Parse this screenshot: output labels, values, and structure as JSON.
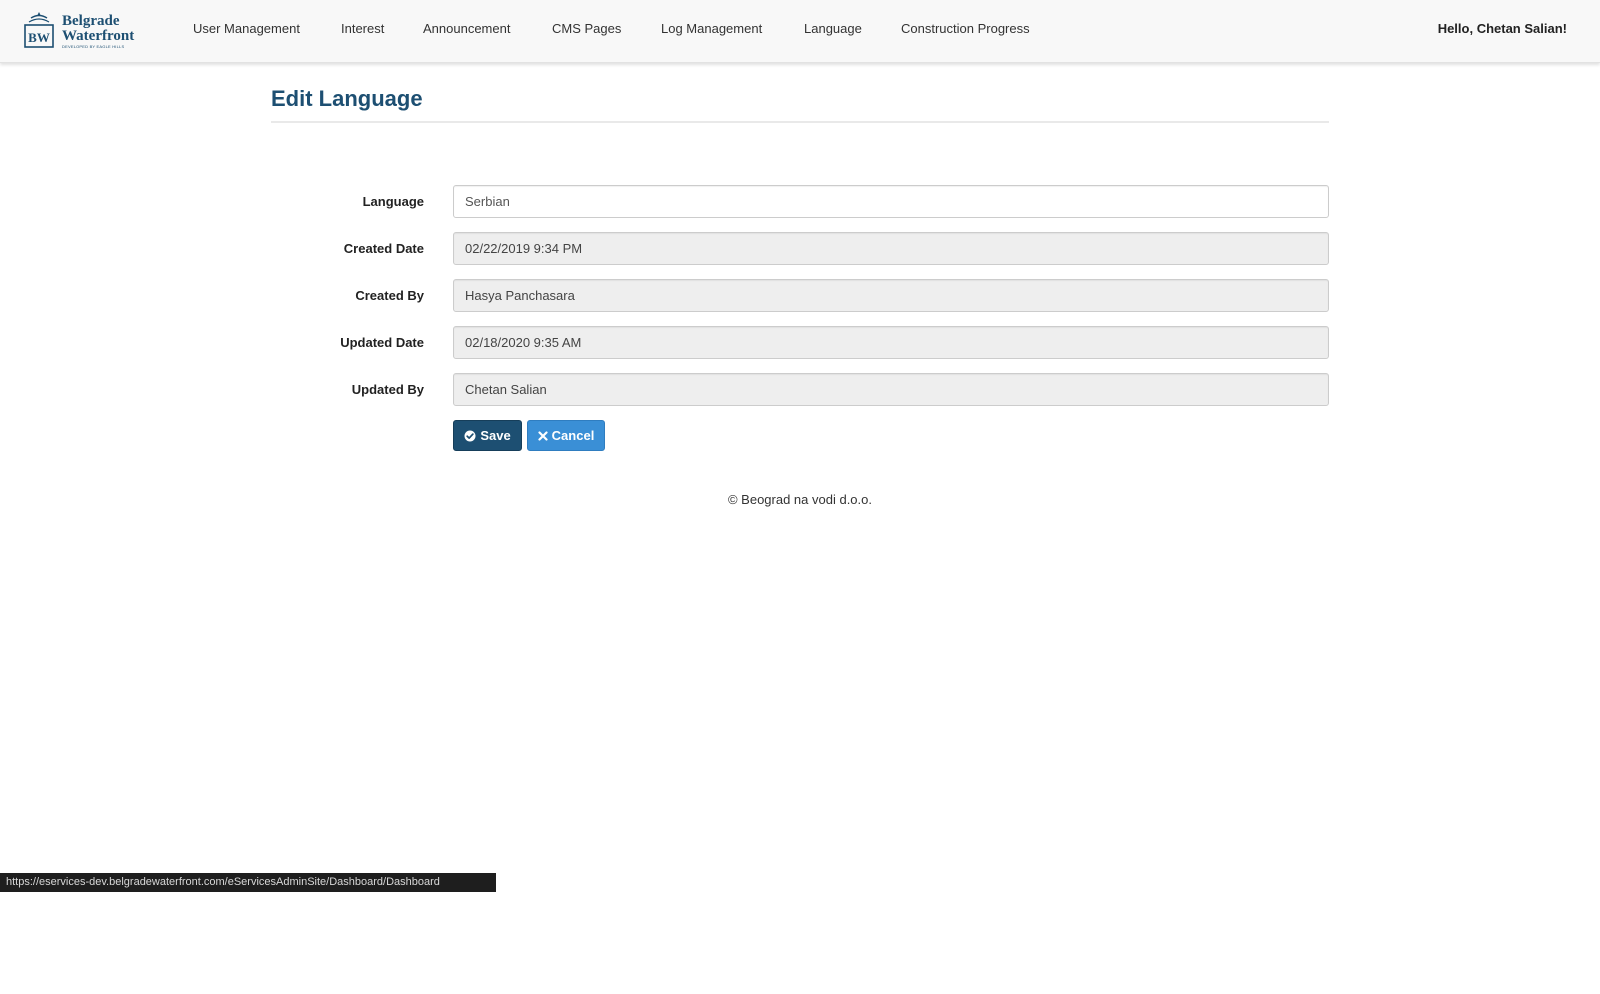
{
  "brand": {
    "line1": "Belgrade",
    "line2": "Waterfront",
    "tagline": "DEVELOPED BY EAGLE HILLS",
    "mark_text": "BW"
  },
  "nav": {
    "items": [
      {
        "label": "User Management"
      },
      {
        "label": "Interest"
      },
      {
        "label": "Announcement"
      },
      {
        "label": "CMS Pages"
      },
      {
        "label": "Log Management"
      },
      {
        "label": "Language"
      },
      {
        "label": "Construction Progress"
      }
    ],
    "greeting": "Hello, Chetan Salian!"
  },
  "page": {
    "title": "Edit Language"
  },
  "form": {
    "fields": [
      {
        "label": "Language",
        "value": "Serbian",
        "readonly": false
      },
      {
        "label": "Created Date",
        "value": "02/22/2019 9:34 PM",
        "readonly": true
      },
      {
        "label": "Created By",
        "value": "Hasya Panchasara",
        "readonly": true
      },
      {
        "label": "Updated Date",
        "value": "02/18/2020 9:35 AM",
        "readonly": true
      },
      {
        "label": "Updated By",
        "value": "Chetan Salian",
        "readonly": true
      }
    ],
    "save_label": "Save",
    "cancel_label": "Cancel",
    "save_icon": "check-circle-icon",
    "cancel_icon": "close-icon"
  },
  "footer": {
    "text": "© Beograd na vodi d.o.o."
  },
  "status_bar": {
    "url": "https://eservices-dev.belgradewaterfront.com/eServicesAdminSite/Dashboard/Dashboard"
  },
  "colors": {
    "brand": "#1d4f72",
    "save_button": "#1d4f72",
    "cancel_button": "#3a8fd6",
    "readonly_field": "#eeeeee",
    "navbar_bg": "#f8f8f8"
  }
}
